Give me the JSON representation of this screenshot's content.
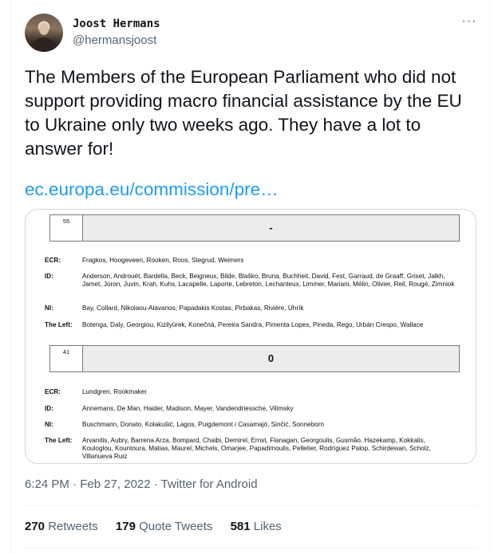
{
  "author": {
    "display_name": "Joost Hermans",
    "handle": "@hermansjoost"
  },
  "more_icon": "more-horizontal-icon",
  "tweet": {
    "text": "The Members of the European Parliament who did not support providing macro financial assistance by the EU to Ukraine only two weeks ago. They have a lot to answer for!",
    "link": "ec.europa.eu/commission/pre…"
  },
  "document": {
    "blocks": [
      {
        "count": "55",
        "vote_sign": "-",
        "groups": [
          {
            "label": "ECR:",
            "names": "Fragkos, Hoogeveen, Rooken, Roos, Stegrud, Weimers"
          },
          {
            "label": "ID:",
            "names": "Anderson, Androuët, Bardella, Beck, Beigneux, Bilde, Blaško, Bruna, Buchheit, David, Fest, Garraud, de Graaff, Griset, Jalkh, Jamet, Joron, Juvin, Krah, Kuhs, Lacapelle, Laporte, Lebreton, Lechanteux, Limmer, Mariani, Mélin, Olivier, Reil, Rougé, Zimniok"
          },
          {
            "label": "NI:",
            "names": "Bay, Collard, Nikolaou-Alavanos, Papadakis Kostas, Pirbakas, Rivière, Uhrík"
          },
          {
            "label": "The Left:",
            "names": "Botenga, Daly, Georgiou, Kizilyürek, Konečná, Pereira Sandra, Pimenta Lopes, Pineda, Rego, Urbán Crespo, Wallace"
          }
        ]
      },
      {
        "count": "41",
        "vote_sign": "0",
        "groups": [
          {
            "label": "ECR:",
            "names": "Lundgren, Rookmaker"
          },
          {
            "label": "ID:",
            "names": "Annemans, De Man, Haider, Madison, Mayer, Vandendriessche, Vilimsky"
          },
          {
            "label": "NI:",
            "names": "Buschmann, Donato, Kolakušić, Lagos, Puigdemont i Casamajó, Sinčić, Sonneborn"
          },
          {
            "label": "The Left:",
            "names": "Arvanitis, Aubry, Barrena Arza, Bompard, Chaibi, Demirel, Ernst, Flanagan, Georgoulis, Gusmão, Hazekamp, Kokkalis, Kouloglou, Kountoura, Matias, Maurel, Michels, Omarjee, Papadimoulis, Pelletier, Rodríguez Palop, Schirdewan, Scholz, Villanueva Ruiz"
          }
        ]
      }
    ]
  },
  "meta": {
    "timestamp": "6:24 PM · Feb 27, 2022 · Twitter for Android"
  },
  "stats": {
    "retweets_count": "270",
    "retweets_label": "Retweets",
    "quotes_count": "179",
    "quotes_label": "Quote Tweets",
    "likes_count": "581",
    "likes_label": "Likes"
  }
}
